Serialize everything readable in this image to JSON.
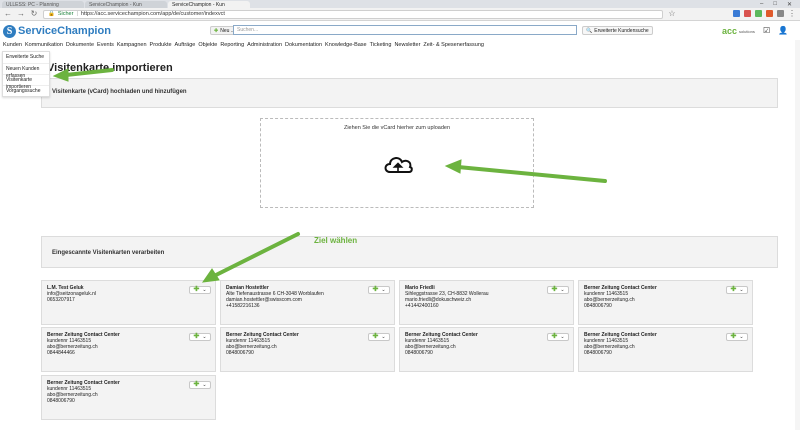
{
  "browser": {
    "tabs": [
      {
        "label": "ULLESS: PC - Planning",
        "active": false
      },
      {
        "label": "ServiceChampion - Kun",
        "active": false
      },
      {
        "label": "ServiceChampion - Kun",
        "active": true
      }
    ],
    "secure_label": "Sicher",
    "url": "https://acc.servicechampion.com/app/de/customer/indexvct"
  },
  "header": {
    "logo_letter": "S",
    "logo_text": "ServiceChampion",
    "new_button": "Neu ...",
    "search_placeholder": "Suchen...",
    "extended_search": "Erweiterte Kundensuche",
    "acc_logo": "acc",
    "acc_sub": "solutions"
  },
  "menu": [
    "Kunden",
    "Kommunikation",
    "Dokumente",
    "Events",
    "Kampagnen",
    "Produkte",
    "Aufträge",
    "Objekte",
    "Reporting",
    "Administration",
    "Dokumentation",
    "Knowledge-Base",
    "Ticketing",
    "Newsletter",
    "Zeit- & Spesenerfassung"
  ],
  "dropdown": [
    "Erweiterte Suche",
    "Neuen Kunden erfassen",
    "Visitenkarte importieren",
    "Vorgangssuche"
  ],
  "page": {
    "title": "Visitenkarte importieren",
    "upload_panel_title": "Visitenkarte (vCard) hochladen und hinzufügen",
    "dropzone_label": "Ziehen Sie die vCard hierher zum uploaden",
    "scanned_panel_title": "Eingescannte Visitenkarten verarbeiten"
  },
  "annotation": "Ziel wählen",
  "cards": [
    {
      "name": "L.M. Test Geluk",
      "lines": [
        "info@seitzonageluk.nl",
        "0653207917"
      ]
    },
    {
      "name": "Damian Hostettler",
      "lines": [
        "Alte Tiefenaustrasse 6 CH-3048 Worblaufen",
        "damian.hostettler@swisscom.com",
        "+41582216136"
      ]
    },
    {
      "name": "Mario Friedli",
      "lines": [
        "Sihleggstrasse 23, CH-8832 Wollerau",
        "mario.friedli@dokuschweiz.ch",
        "+41442400160"
      ]
    },
    {
      "name": "Berner Zeitung Contact Center",
      "lines": [
        "kundennr 11463515",
        "abo@bernerzeitung.ch",
        "0848006790"
      ]
    },
    {
      "name": "Berner Zeitung Contact Center",
      "lines": [
        "kundennr 11463515",
        "abo@bernerzeitung.ch",
        "0844844466"
      ]
    },
    {
      "name": "Berner Zeitung Contact Center",
      "lines": [
        "kundennr 11463515",
        "abo@bernerzeitung.ch",
        "0848006790"
      ]
    },
    {
      "name": "Berner Zeitung Contact Center",
      "lines": [
        "kundennr 11463515",
        "abo@bernerzeitung.ch",
        "0848006790"
      ]
    },
    {
      "name": "Berner Zeitung Contact Center",
      "lines": [
        "kundennr 11463515",
        "abo@bernerzeitung.ch",
        "0848006790"
      ]
    },
    {
      "name": "Berner Zeitung Contact Center",
      "lines": [
        "kundennr 11463515",
        "abo@bernerzeitung.ch",
        "0848006790"
      ]
    }
  ],
  "colors": {
    "brand": "#2f7dc0",
    "accent_green": "#6cb33f"
  }
}
